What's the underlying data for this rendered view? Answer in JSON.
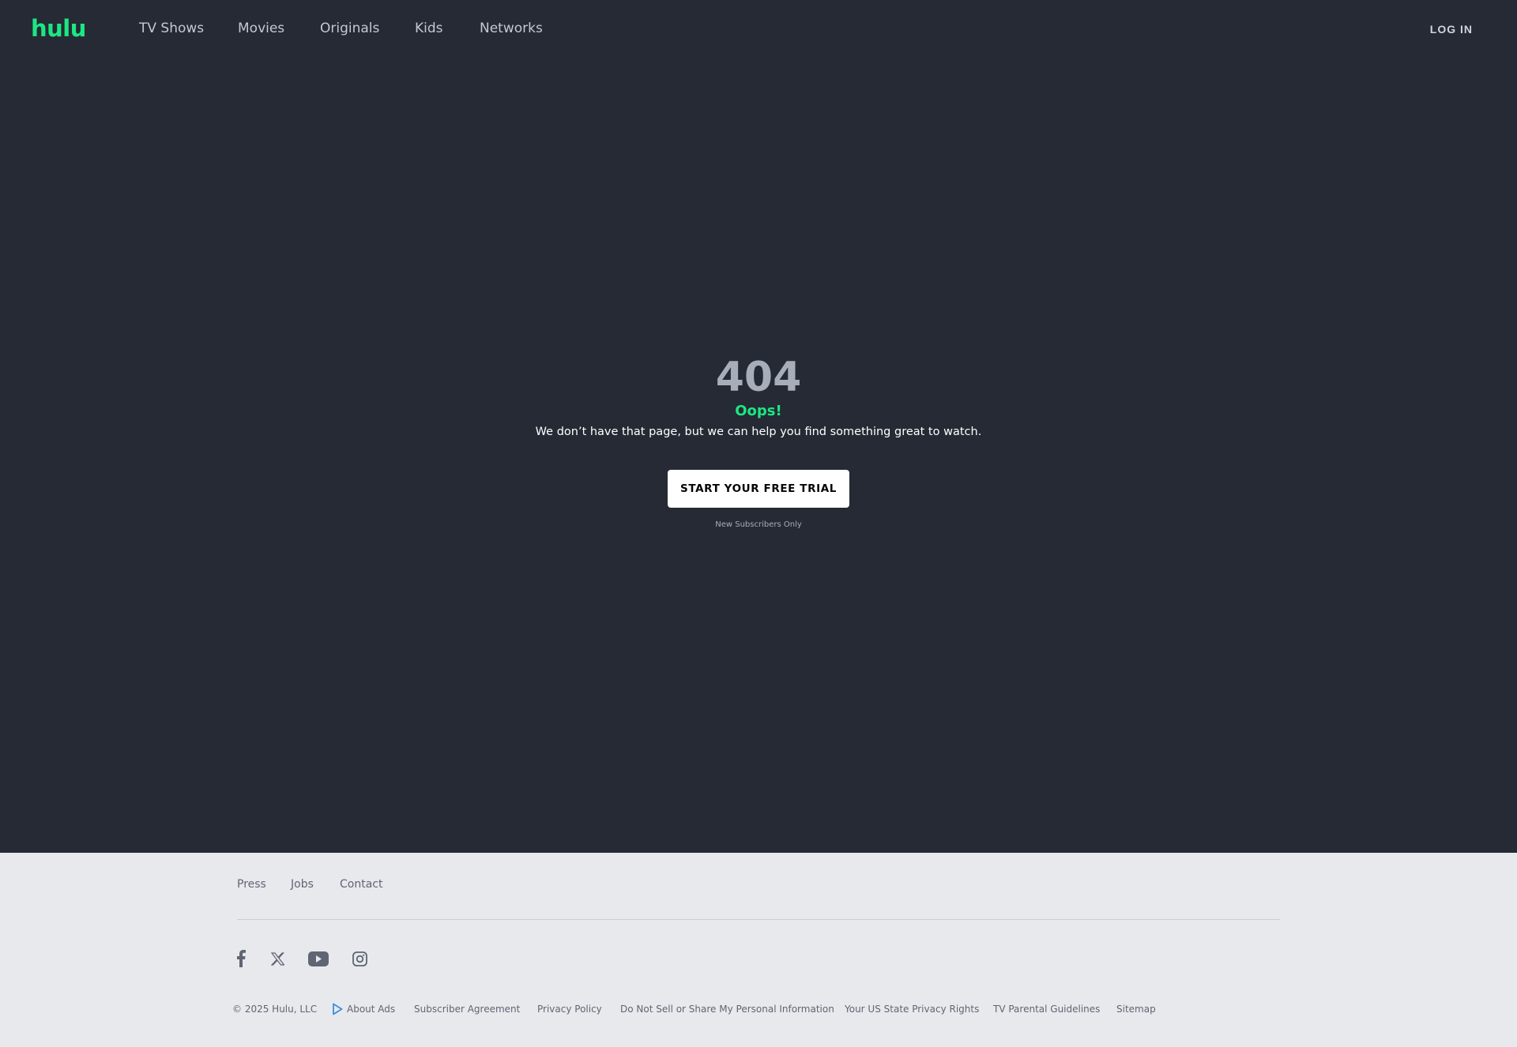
{
  "header": {
    "logo": "hulu",
    "nav": [
      "TV Shows",
      "Movies",
      "Originals",
      "Kids",
      "Networks"
    ],
    "login": "LOG IN"
  },
  "error": {
    "code": "404",
    "headline": "Oops!",
    "message": "We don’t have that page, but we can help you find something great to watch.",
    "cta": "START YOUR FREE TRIAL",
    "fineprint": "New Subscribers Only"
  },
  "footer": {
    "links": [
      "Press",
      "Jobs",
      "Contact"
    ],
    "social": [
      "facebook-icon",
      "x-icon",
      "youtube-icon",
      "instagram-icon"
    ],
    "copyright": "© 2025 Hulu, LLC",
    "legal": [
      "About Ads",
      "Subscriber Agreement",
      "Privacy Policy",
      "Do Not Sell or Share My Personal Information",
      "Your US State Privacy Rights",
      "TV Parental Guidelines",
      "Sitemap"
    ]
  },
  "colors": {
    "background": "#252a34",
    "brand": "#1ce783",
    "footer": "#e8e9ed"
  }
}
